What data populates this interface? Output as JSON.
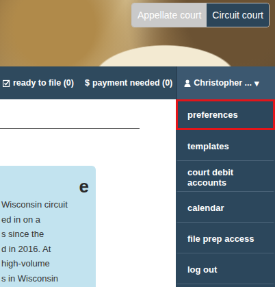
{
  "court_toggle": [
    {
      "label": "Appellate court",
      "selected": false
    },
    {
      "label": "Circuit court",
      "selected": true
    }
  ],
  "nav": {
    "items": [
      {
        "label": "ready to file (0)"
      },
      {
        "icon": "$",
        "label": "payment needed (0)"
      }
    ],
    "user": {
      "label": "Christopher ...",
      "caret": "▾"
    }
  },
  "menu": {
    "items": [
      {
        "label": "preferences",
        "selected": true
      },
      {
        "label": "templates",
        "selected": false
      },
      {
        "label": "court debit accounts",
        "selected": false
      },
      {
        "label": "calendar",
        "selected": false
      },
      {
        "label": "file prep access",
        "selected": false
      },
      {
        "label": "log out",
        "selected": false
      }
    ]
  },
  "card": {
    "heading": "e",
    "lines": [
      "Wisconsin circuit",
      "ed in on a",
      "s since the",
      "d in 2016. At",
      "high-volume",
      "s in Wisconsin"
    ]
  }
}
